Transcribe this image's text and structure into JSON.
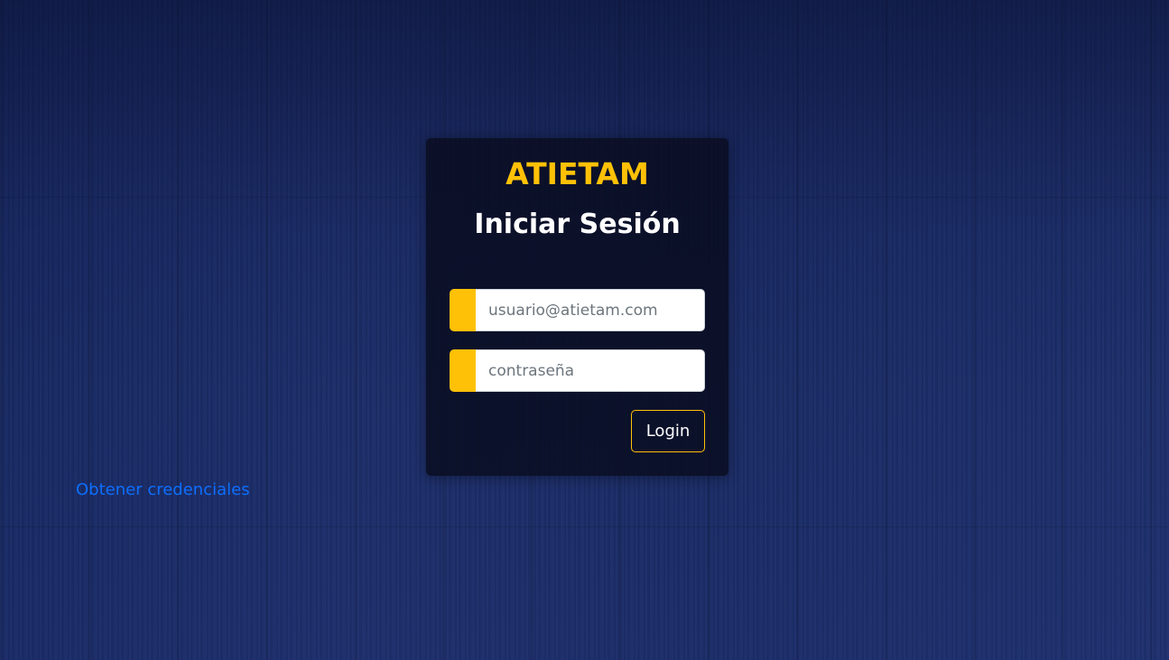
{
  "brand": {
    "name": "ATIETAM"
  },
  "login_form": {
    "title": "Iniciar Sesión",
    "email_field": {
      "value": "",
      "placeholder": "usuario@atietam.com"
    },
    "password_field": {
      "value": "",
      "placeholder": "contraseña"
    },
    "submit_label": "Login"
  },
  "links": {
    "get_credentials": "Obtener credenciales"
  },
  "colors": {
    "accent": "#ffc107",
    "link": "#0d6efd",
    "card_background": "#0a0e22",
    "page_background": "#1b2b63"
  }
}
